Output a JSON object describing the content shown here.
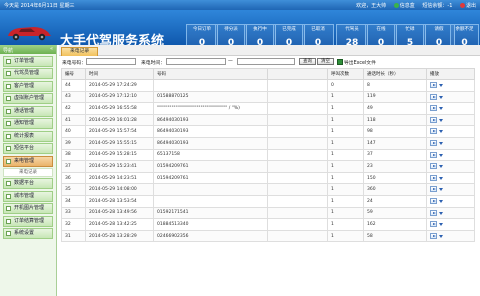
{
  "topbar": {
    "date": "今天是 2014年6月11日 星期三",
    "welcome": "欢迎，王大帅",
    "info": "信息盒",
    "sms": "短信余额：-1",
    "exit": "退出"
  },
  "app_title": "大手代驾服务系统",
  "stats": [
    {
      "label": "今日订单",
      "value": "0"
    },
    {
      "label": "待分派",
      "value": "0"
    },
    {
      "label": "执行中",
      "value": "0"
    },
    {
      "label": "已完成",
      "value": "0"
    },
    {
      "label": "已取消",
      "value": "0"
    },
    {
      "label": "代驾员",
      "value": "28"
    },
    {
      "label": "在线",
      "value": "0"
    },
    {
      "label": "忙碌",
      "value": "5"
    },
    {
      "label": "请假",
      "value": "0"
    },
    {
      "label": "余额不足",
      "value": "0"
    }
  ],
  "sidebar": {
    "header": "导航",
    "items": [
      "订单管理",
      "代驾员管理",
      "客户管理",
      "虚拟账户管理",
      "通话管理",
      "通知管理",
      "统计报表",
      "短信平台",
      "来电管理",
      "数据平台",
      "城市管理",
      "开机图片管理",
      "订单结算管理",
      "系统设置"
    ],
    "sub_item": "来电记录"
  },
  "tab": "来电记录",
  "filter": {
    "phone_label": "来电号码：",
    "time_label": "来电时间：",
    "range_sep": "—",
    "query_button": "查询",
    "clear_button": "清空",
    "export": "导出Excel文件"
  },
  "table": {
    "headers": [
      "编号",
      "时间",
      "号码",
      "",
      "呼叫次数",
      "通话时长（秒）",
      "播放"
    ],
    "rows": [
      [
        "44",
        "2014-05-29 17:24:29",
        "",
        "",
        "0",
        "8",
        ""
      ],
      [
        "43",
        "2014-05-29 17:12:10",
        "01588870125",
        "",
        "1",
        "119",
        ""
      ],
      [
        "42",
        "2014-05-29 16:55:58",
        "\"\"\"\"\"\"\"\"\"\"\"\"\"\"\"\"\"\"\"\"\"\"\"\"\"\"\"\"\"\"\"\"\"\" / \"%)",
        "",
        "1",
        "49",
        ""
      ],
      [
        "41",
        "2014-05-29 16:01:28",
        "86494030193",
        "",
        "1",
        "118",
        ""
      ],
      [
        "40",
        "2014-05-29 15:57:54",
        "86494030193",
        "",
        "1",
        "98",
        ""
      ],
      [
        "39",
        "2014-05-29 15:55:15",
        "86494030193",
        "",
        "1",
        "147",
        ""
      ],
      [
        "38",
        "2014-05-29 15:28:15",
        "65137158",
        "",
        "1",
        "37",
        ""
      ],
      [
        "37",
        "2014-05-29 15:23:41",
        "01594209761",
        "",
        "1",
        "23",
        ""
      ],
      [
        "36",
        "2014-05-29 14:23:51",
        "01594209761",
        "",
        "1",
        "150",
        ""
      ],
      [
        "35",
        "2014-05-29 14:08:00",
        "",
        "",
        "1",
        "360",
        ""
      ],
      [
        "34",
        "2014-05-28 13:53:54",
        "",
        "",
        "1",
        "24",
        ""
      ],
      [
        "33",
        "2014-05-28 13:49:56",
        "01592171541",
        "",
        "1",
        "59",
        ""
      ],
      [
        "32",
        "2014-05-28 13:42:25",
        "01884513340",
        "",
        "1",
        "162",
        ""
      ],
      [
        "31",
        "2014-05-28 13:28:29",
        "02466902356",
        "",
        "1",
        "58",
        ""
      ]
    ]
  },
  "colors": {
    "header_blue": "#1f66b4",
    "sidebar_green": "#6db150",
    "active_orange": "#eab36a"
  }
}
